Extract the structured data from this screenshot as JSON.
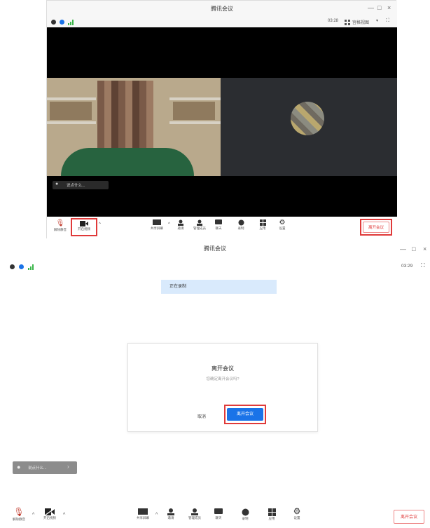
{
  "top_window": {
    "title": "腾讯会议",
    "time": "03:28",
    "view_label": "宫格视图",
    "chat_prompt": "说点什么...",
    "toolbar": {
      "mute": "解除静音",
      "video": "开启视频",
      "share": "共享屏幕",
      "invite": "邀请",
      "members": "管理成员",
      "chat": "聊天",
      "record": "录制",
      "apps": "应用",
      "settings": "设置",
      "leave": "离开会议"
    }
  },
  "bottom_window": {
    "title": "腾讯会议",
    "time": "03:29",
    "banner": "正在录制",
    "dialog": {
      "title": "离开会议",
      "message": "您确定离开会议吗?",
      "cancel": "取消",
      "confirm": "离开会议"
    },
    "chat_prompt": "说点什么...",
    "toolbar": {
      "mute": "解除静音",
      "video": "开启视频",
      "share": "共享屏幕",
      "invite": "邀请",
      "members": "管理成员",
      "chat": "聊天",
      "record": "录制",
      "apps": "应用",
      "settings": "设置",
      "leave": "离开会议"
    }
  },
  "colors": {
    "accent_blue": "#1a73e8",
    "record_red": "#e03a3a",
    "signal_green": "#3bb54a",
    "banner_blue": "#d9eafc"
  },
  "icons": [
    "info-icon",
    "shield-icon",
    "signal-icon",
    "grid-icon",
    "fullscreen-icon",
    "mic-icon",
    "camera-icon",
    "share-screen-icon",
    "invite-icon",
    "members-icon",
    "chat-icon",
    "record-icon",
    "apps-icon",
    "settings-icon",
    "chevron-up-icon"
  ]
}
